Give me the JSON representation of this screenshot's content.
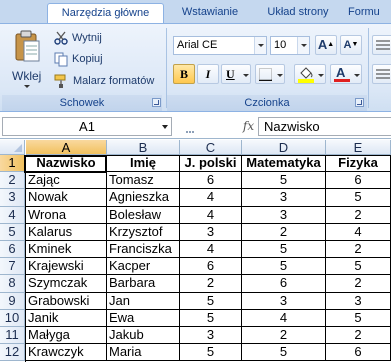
{
  "ribbon": {
    "tabs": [
      {
        "label": "Narzędzia główne",
        "active": true
      },
      {
        "label": "Wstawianie",
        "active": false
      },
      {
        "label": "Układ strony",
        "active": false
      },
      {
        "label": "Formu",
        "active": false
      }
    ],
    "clipboard": {
      "paste_label": "Wklej",
      "cut_label": "Wytnij",
      "copy_label": "Kopiuj",
      "format_painter_label": "Malarz formatów",
      "group_label": "Schowek"
    },
    "font": {
      "font_name": "Arial CE",
      "font_size": "10",
      "bold": "B",
      "italic": "I",
      "underline": "U",
      "font_color_glyph": "A",
      "grow_glyph": "A",
      "shrink_glyph": "A",
      "group_label": "Czcionka",
      "font_color": "#e02020",
      "fill_color": "#ffff00"
    }
  },
  "formula_bar": {
    "cell_ref": "A1",
    "fx": "fx",
    "content": "Nazwisko"
  },
  "sheet": {
    "columns": [
      "A",
      "B",
      "C",
      "D",
      "E"
    ],
    "selected_column": "A",
    "selected_row": 1,
    "rows": [
      {
        "n": "1",
        "cells": [
          "Nazwisko",
          "Imię",
          "J. polski",
          "Matematyka",
          "Fizyka"
        ]
      },
      {
        "n": "2",
        "cells": [
          "Zając",
          "Tomasz",
          "6",
          "5",
          "6"
        ]
      },
      {
        "n": "3",
        "cells": [
          "Nowak",
          "Agnieszka",
          "4",
          "3",
          "5"
        ]
      },
      {
        "n": "4",
        "cells": [
          "Wrona",
          "Bolesław",
          "4",
          "3",
          "2"
        ]
      },
      {
        "n": "5",
        "cells": [
          "Kalarus",
          "Krzysztof",
          "3",
          "2",
          "4"
        ]
      },
      {
        "n": "6",
        "cells": [
          "Kminek",
          "Franciszka",
          "4",
          "5",
          "2"
        ]
      },
      {
        "n": "7",
        "cells": [
          "Krajewski",
          "Kacper",
          "6",
          "5",
          "5"
        ]
      },
      {
        "n": "8",
        "cells": [
          "Szymczak",
          "Barbara",
          "2",
          "6",
          "2"
        ]
      },
      {
        "n": "9",
        "cells": [
          "Grabowski",
          "Jan",
          "5",
          "3",
          "3"
        ]
      },
      {
        "n": "10",
        "cells": [
          "Janik",
          "Ewa",
          "5",
          "4",
          "5"
        ]
      },
      {
        "n": "11",
        "cells": [
          "Małyga",
          "Jakub",
          "3",
          "2",
          "2"
        ]
      },
      {
        "n": "12",
        "cells": [
          "Krawczyk",
          "Maria",
          "5",
          "5",
          "6"
        ]
      }
    ]
  }
}
